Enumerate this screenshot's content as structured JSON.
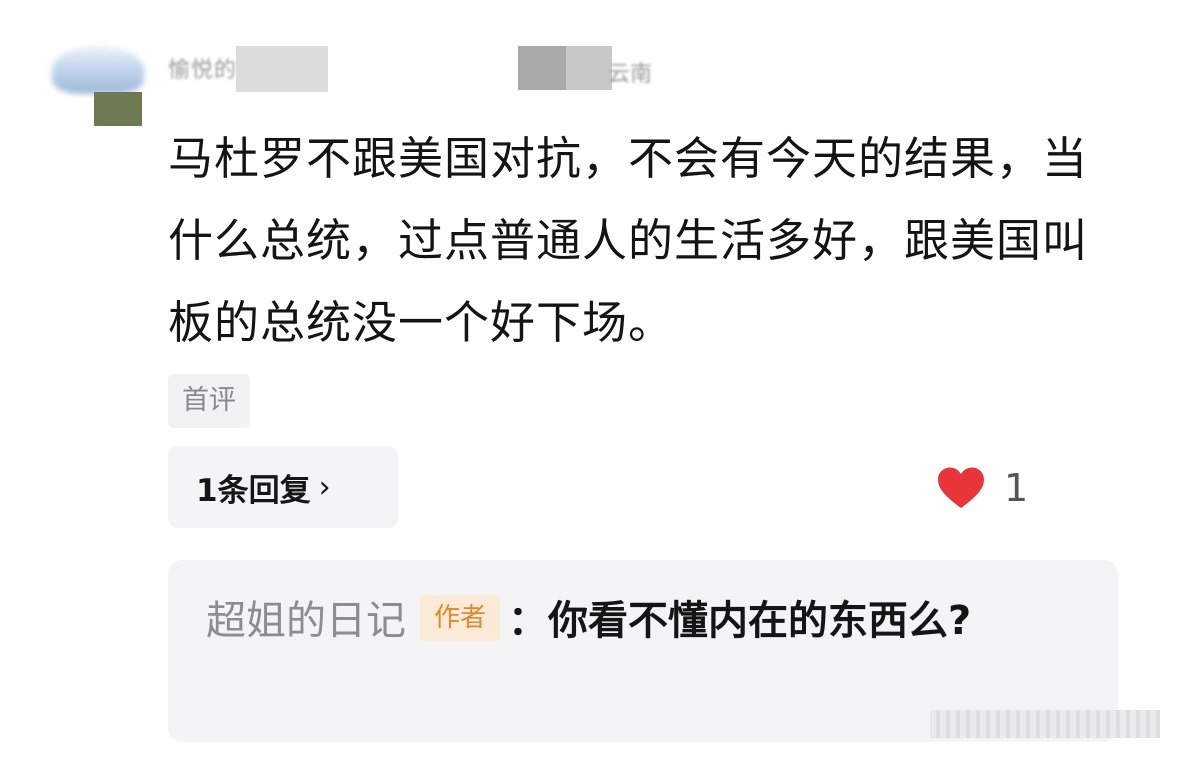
{
  "comment": {
    "user_name": "愉悦的",
    "location": "云南",
    "text": "马杜罗不跟美国对抗，不会有今天的结果，当什么总统，过点普通人的生活多好，跟美国叫板的总统没一个好下场。",
    "first_comment_tag": "首评",
    "replies_label": "1条回复",
    "chevron": "›",
    "like_count": "1",
    "like_color": "#e8353a"
  },
  "reply": {
    "author": "超姐的日记",
    "author_badge": "作者",
    "text": "：你看不懂内在的东西么?"
  }
}
